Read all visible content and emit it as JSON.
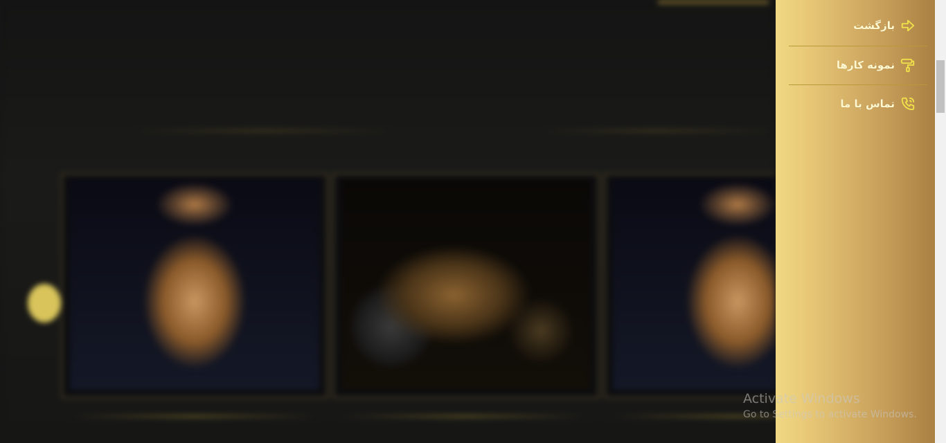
{
  "drawer": {
    "items": [
      {
        "label": "بازگشت",
        "icon": "arrow-right-icon"
      },
      {
        "label": "نمونه کارها",
        "icon": "paint-roller-icon"
      },
      {
        "label": "تماس با ما",
        "icon": "phone-icon"
      }
    ]
  },
  "watermark": {
    "line1": "Activate Windows",
    "line2": "Go to Settings to activate Windows."
  },
  "colors": {
    "accent": "#f1e24a",
    "drawer_light": "#f0d883",
    "drawer_dark": "#a98042",
    "page_bg": "#161616"
  }
}
